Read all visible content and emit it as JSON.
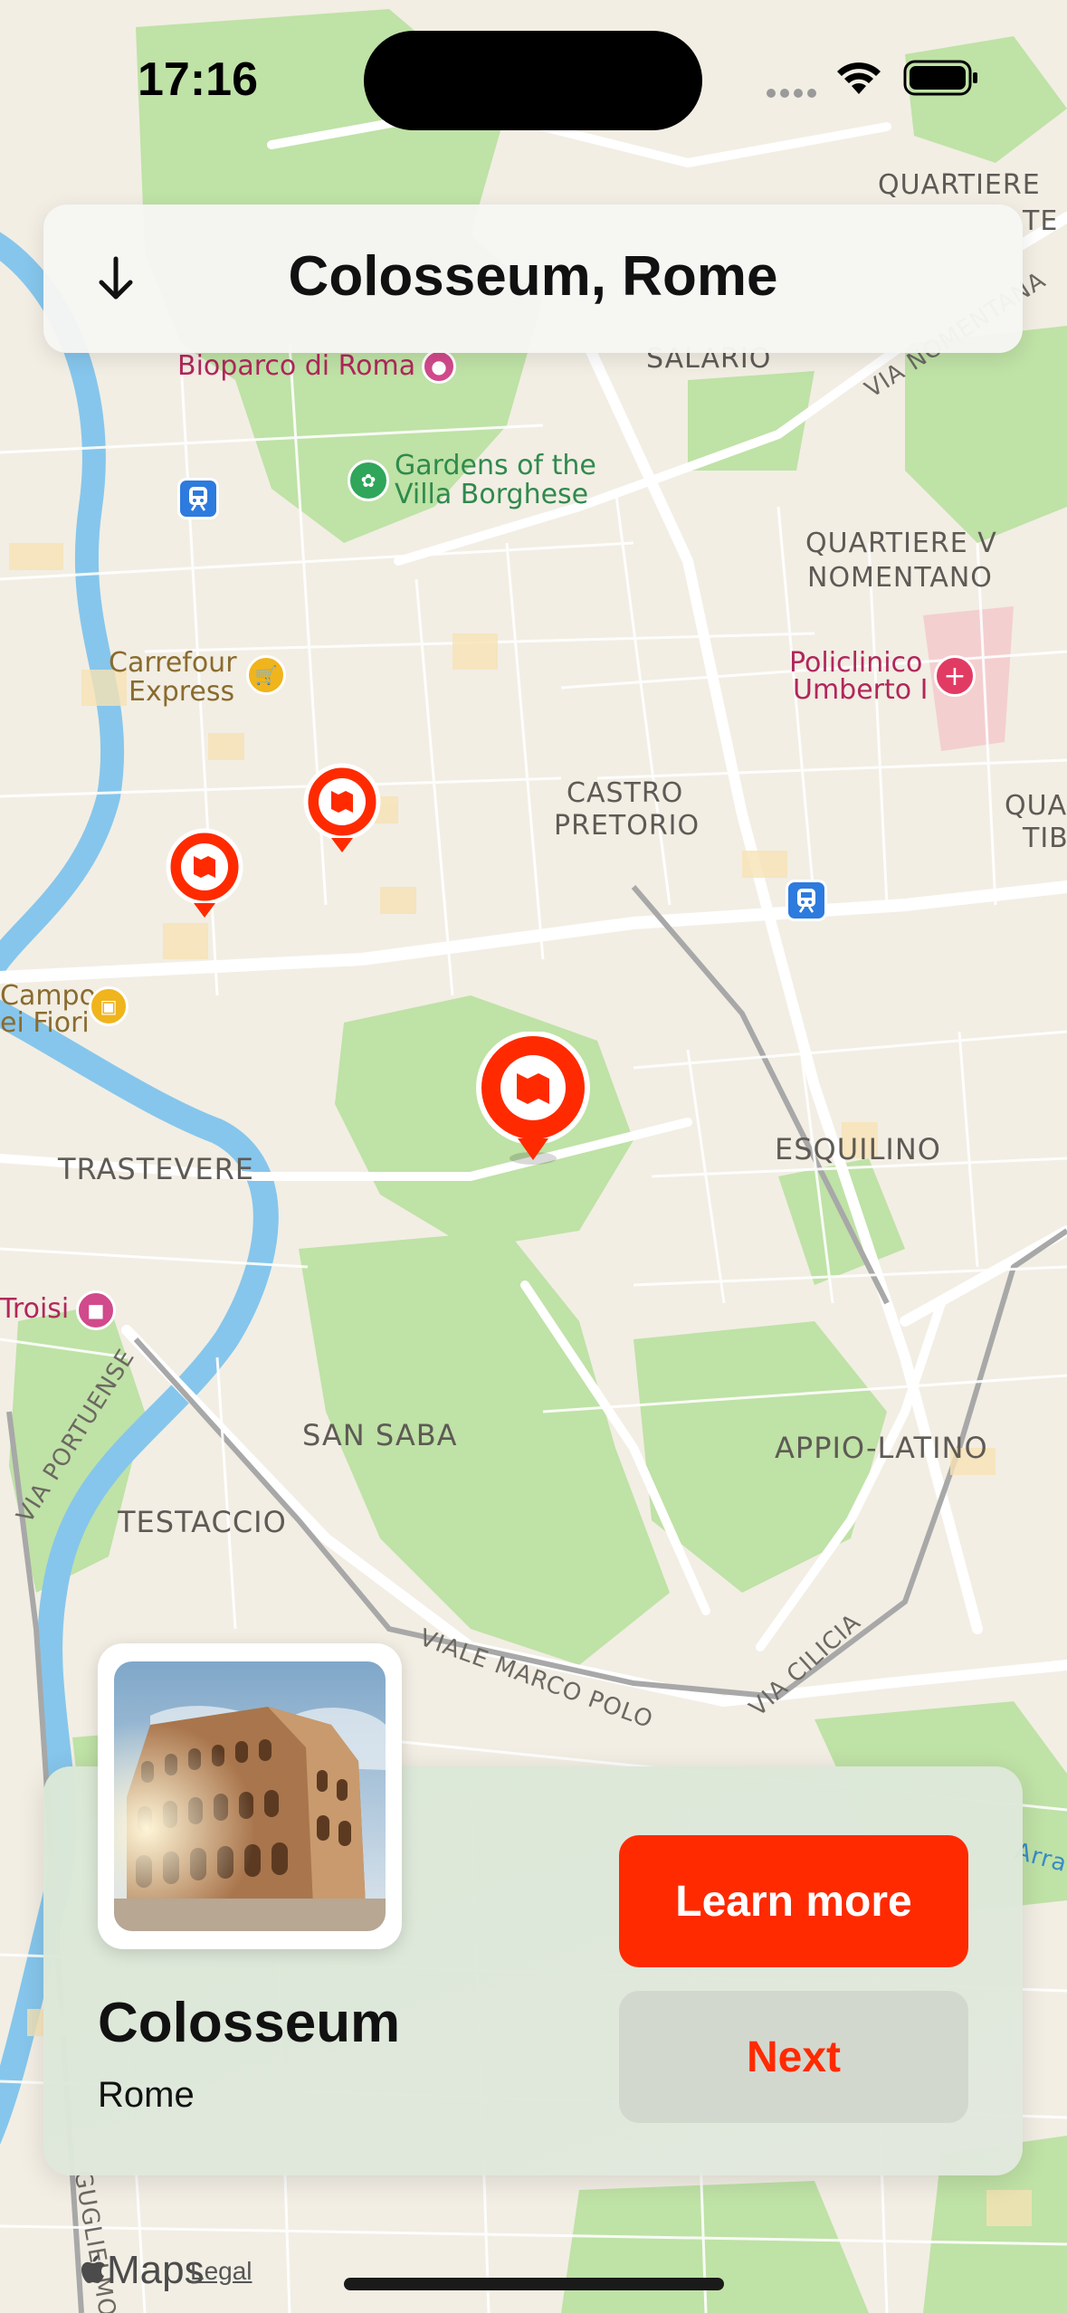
{
  "status_bar": {
    "time": "17:16"
  },
  "header": {
    "title": "Colosseum, Rome"
  },
  "map": {
    "labels": {
      "quartiere_top_1": "QUARTIERE",
      "quartiere_top_2": "TE",
      "salario": "SALARIO",
      "via_nomentana": "VIA NOMENTANA",
      "bioparco": "Bioparco di Roma",
      "gardens_1": "Gardens of the",
      "gardens_2": "Villa Borghese",
      "quartiere_v_1": "QUARTIERE V",
      "quartiere_v_2": "NOMENTANO",
      "carrefour_1": "Carrefour",
      "carrefour_2": "Express",
      "policlinico_1": "Policlinico",
      "policlinico_2": "Umberto I",
      "castro_1": "CASTRO",
      "castro_2": "PRETORIO",
      "quar_right_1": "QUAR",
      "quar_right_2": "TIB",
      "campo_1": "Campo",
      "campo_2": "ei Fiori",
      "trastevere": "TRASTEVERE",
      "esquilino": "ESQUILINO",
      "troisi": "Troisi",
      "via_portuense": "VIA PORTUENSE",
      "san_saba": "SAN SABA",
      "appio_latino": "APPIO-LATINO",
      "testaccio": "TESTACCIO",
      "viale_marco_polo": "VIALE MARCO POLO",
      "via_cilicia": "VIA CILICIA",
      "arra": "Arra",
      "guglielmo": "GUGLIELMO"
    }
  },
  "card": {
    "name": "Colosseum",
    "city": "Rome",
    "learn_more": "Learn more",
    "next": "Next"
  },
  "attribution": {
    "maps": "Maps",
    "legal": "Legal"
  },
  "colors": {
    "accent": "#ff2a00",
    "secondary_button": "#d3d8cf",
    "park": "#b9dea0",
    "water": "#79bfe6"
  },
  "icons": [
    "wifi-icon",
    "battery-icon",
    "arrow-down-icon",
    "map-pin-icon",
    "train-icon",
    "cart-icon",
    "hospital-icon",
    "elephant-icon",
    "flower-icon",
    "camera-icon",
    "bag-icon",
    "apple-icon"
  ]
}
